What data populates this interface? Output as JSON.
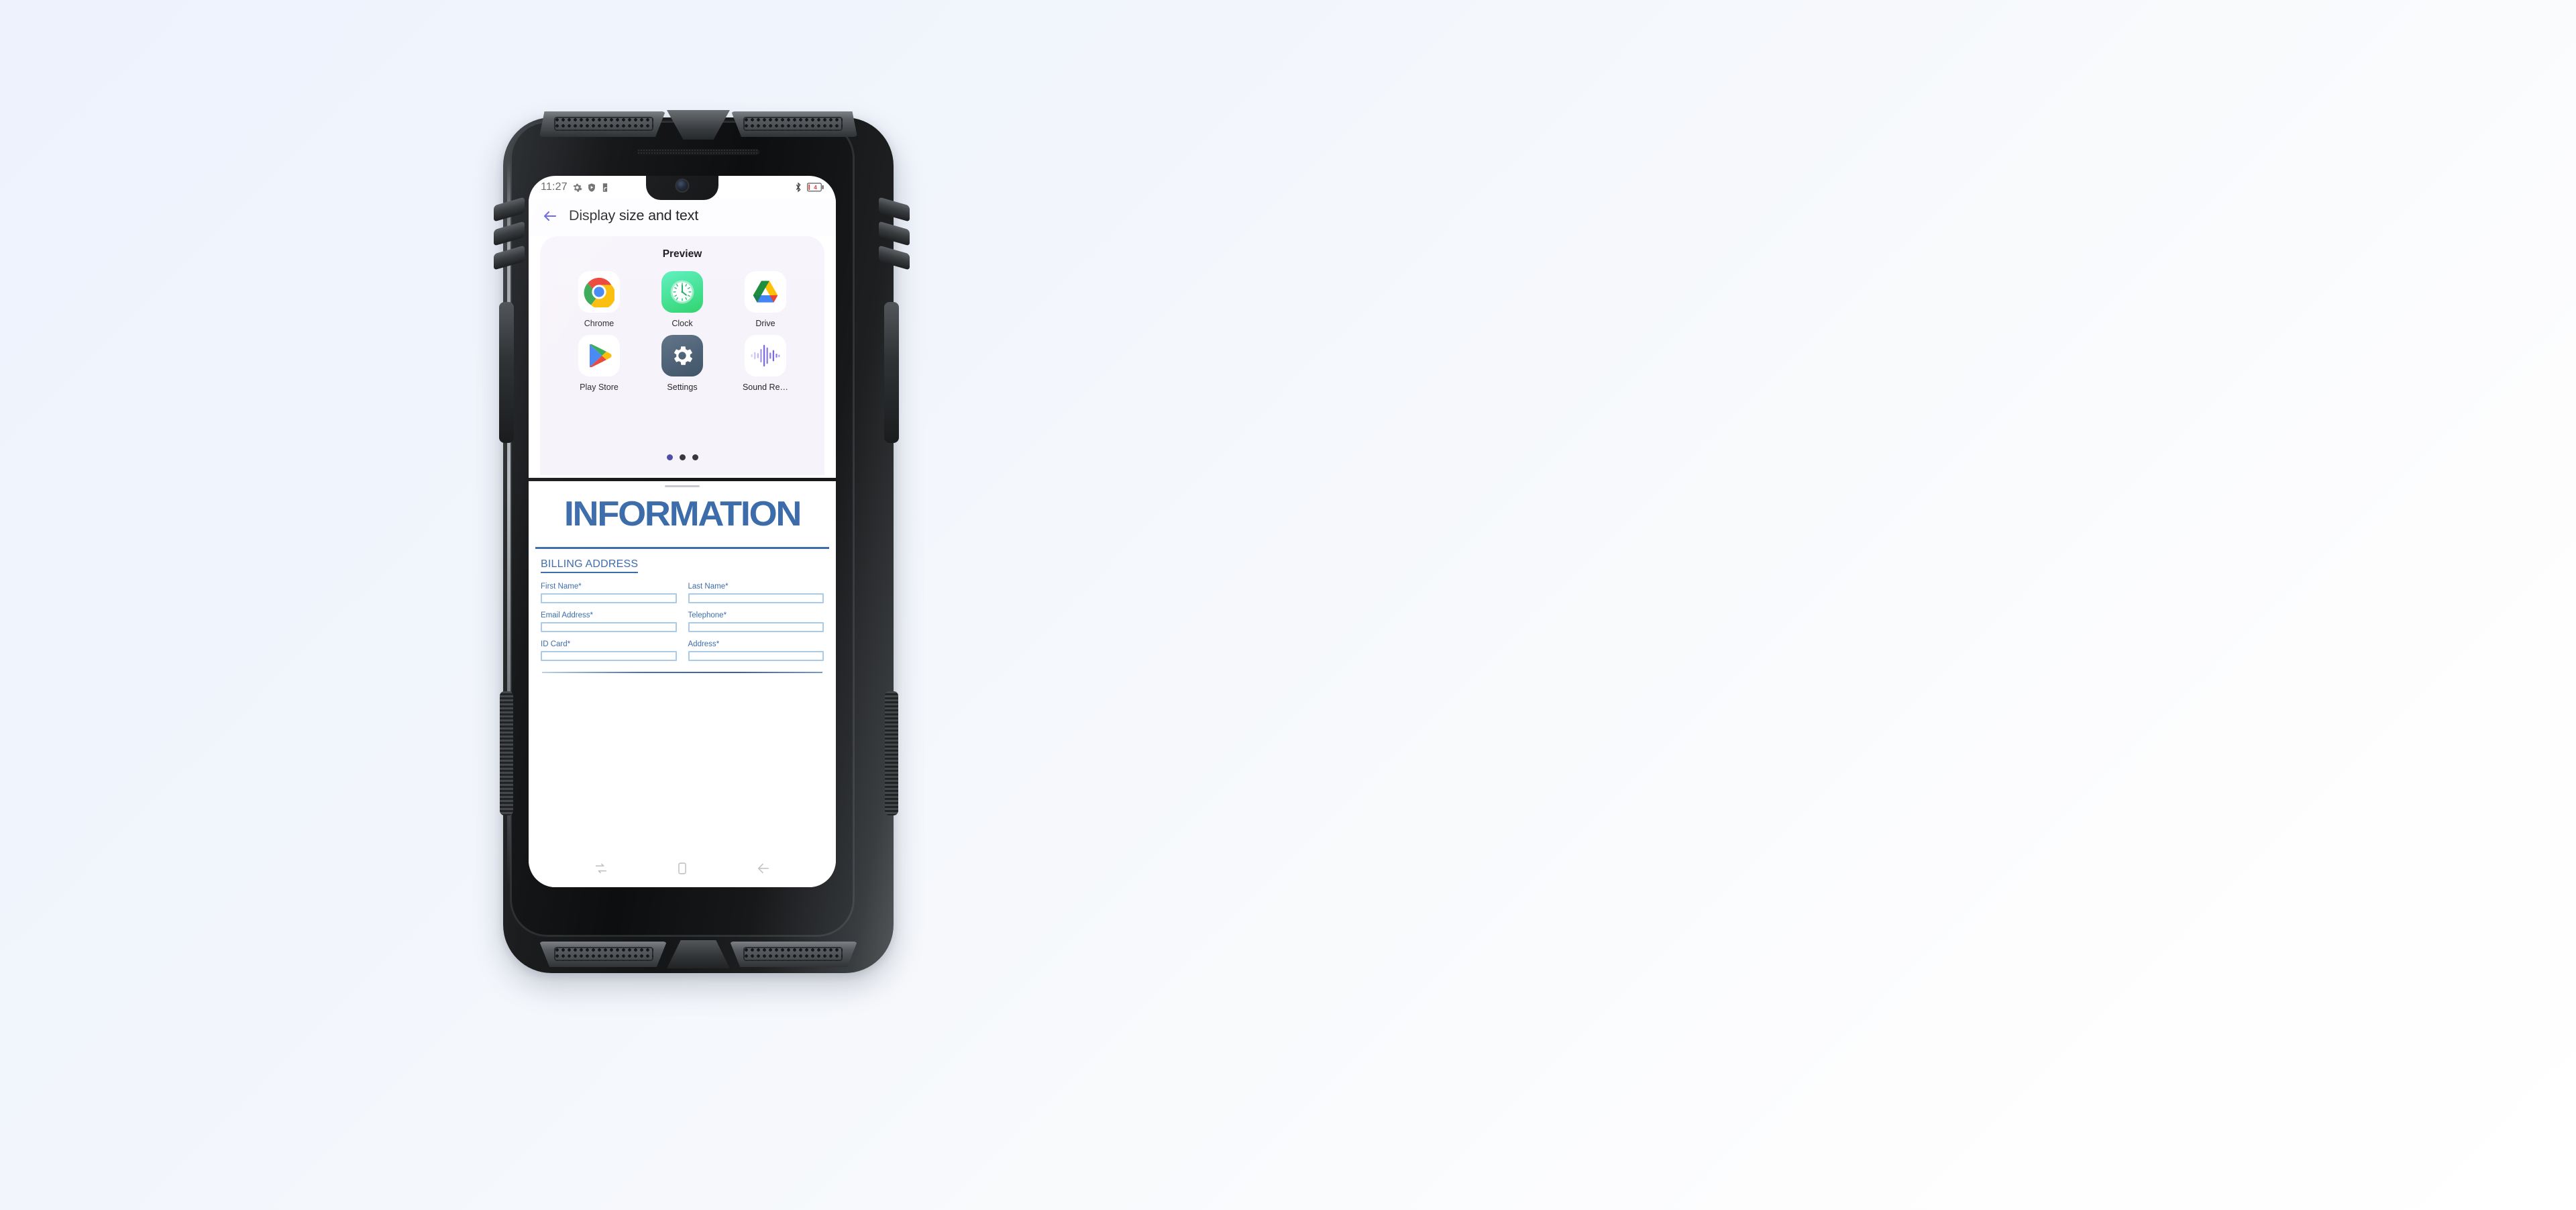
{
  "status_bar": {
    "time": "11:27",
    "left_icons": [
      "gear-icon",
      "play-protect-shield-icon",
      "nfc-tag-icon"
    ],
    "right_icons": [
      "bluetooth-icon",
      "battery-icon"
    ],
    "battery_level": "4"
  },
  "app": {
    "back_label": "back-arrow",
    "title": "Display size and text",
    "accent_color": "#4b44e0"
  },
  "preview": {
    "label": "Preview",
    "apps": [
      {
        "name": "Chrome",
        "icon": "chrome-icon"
      },
      {
        "name": "Clock",
        "icon": "clock-icon"
      },
      {
        "name": "Drive",
        "icon": "google-drive-icon"
      },
      {
        "name": "Play Store",
        "icon": "play-store-icon"
      },
      {
        "name": "Settings",
        "icon": "settings-gear-icon"
      },
      {
        "name": "Sound Re…",
        "icon": "sound-recorder-icon"
      }
    ],
    "page_dots": 3,
    "active_dot": 0
  },
  "document": {
    "title": "INFORMATION",
    "section_heading": "BILLING ADDRESS",
    "title_color": "#3d6cab",
    "fields": [
      {
        "label": "First Name",
        "required": "*",
        "value": ""
      },
      {
        "label": "Last Name",
        "required": "*",
        "value": ""
      },
      {
        "label": "Email Address",
        "required": "*",
        "value": ""
      },
      {
        "label": "Telephone",
        "required": "*",
        "value": ""
      },
      {
        "label": "ID Card",
        "required": "*",
        "value": ""
      },
      {
        "label": "Address",
        "required": "*",
        "value": ""
      }
    ]
  },
  "nav_bar": {
    "buttons": [
      {
        "name": "recents-button",
        "icon": "recents-icon"
      },
      {
        "name": "home-button",
        "icon": "home-rounded-square-icon"
      },
      {
        "name": "back-button",
        "icon": "back-arrow-icon"
      }
    ]
  }
}
